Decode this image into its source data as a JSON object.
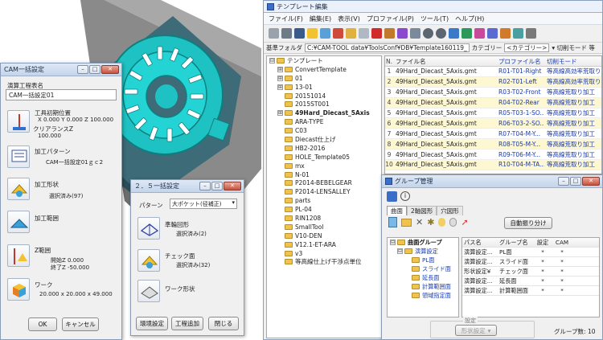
{
  "cam_dialog": {
    "title": "CAM一括設定",
    "section_label": "演算工程表名",
    "process_name": "CAM一括設定01",
    "tool_pos_label": "工具初期位置",
    "tool_pos_value": "X 0.000 Y 0.000 Z 100.000",
    "clearance_label": "クリアランスZ",
    "clearance_value": "100.000",
    "pattern_label": "加工パターン",
    "pattern_value": "CAM一括設定01ｇｃ2",
    "shape_label": "加工形状",
    "shape_value": "選択済み(97)",
    "range_label": "加工範囲",
    "zrange_label": "Z範囲",
    "zstart_value": "開始Z 0.000",
    "zend_value": "終了Z -50.000",
    "work_label": "ワーク",
    "work_value": "20.000 x 20.000 x 49.000",
    "ok_label": "OK",
    "cancel_label": "キャンセル"
  },
  "five_axis_dialog": {
    "title": "２．５一括設定",
    "pattern_label": "パターン",
    "pattern_select": "大ポケット(径補正)",
    "quasi_label": "準輪回形",
    "quasi_value": "選択済み(2)",
    "check_label": "チェック面",
    "check_value": "選択済み(32)",
    "work_shape_label": "ワーク形状",
    "env_button": "環境設定",
    "add_button": "工程追加",
    "close_button": "閉じる"
  },
  "editor": {
    "title": "テンプレート編集",
    "menus": [
      "ファイル(F)",
      "編集(E)",
      "表示(V)",
      "プロファイル(P)",
      "ツール(T)",
      "ヘルプ(H)"
    ],
    "path_label": "基準フォルダ",
    "path_value": "C:¥CAM-TOOL data¥ToolsConf¥DB¥Template160119_",
    "category_label": "カテゴリー",
    "category_value": "<カテゴリー>",
    "mode_label": "▾ 切削モード 等",
    "tree": [
      {
        "label": "テンプレート",
        "expander": "⊟",
        "indent": 0
      },
      {
        "label": "ConvertTemplate",
        "expander": "⊞",
        "indent": 1
      },
      {
        "label": "01",
        "expander": "⊞",
        "indent": 1
      },
      {
        "label": "13-01",
        "expander": "⊞",
        "indent": 1
      },
      {
        "label": "20151014",
        "expander": "",
        "indent": 1
      },
      {
        "label": "2015ST001",
        "expander": "",
        "indent": 1
      },
      {
        "label": "49Hard_Diecast_5Axis",
        "expander": "⊞",
        "indent": 1,
        "bold": true
      },
      {
        "label": "ARA-TYPE",
        "expander": "",
        "indent": 1
      },
      {
        "label": "C03",
        "expander": "",
        "indent": 1
      },
      {
        "label": "Diecast仕上げ",
        "expander": "",
        "indent": 1
      },
      {
        "label": "HB2-2016",
        "expander": "",
        "indent": 1
      },
      {
        "label": "HOLE_Template05",
        "expander": "",
        "indent": 1
      },
      {
        "label": "mx",
        "expander": "",
        "indent": 1
      },
      {
        "label": "N-01",
        "expander": "",
        "indent": 1
      },
      {
        "label": "P2014-BEBELGEAR",
        "expander": "",
        "indent": 1
      },
      {
        "label": "P2014-LENSALLEY",
        "expander": "",
        "indent": 1
      },
      {
        "label": "parts",
        "expander": "",
        "indent": 1
      },
      {
        "label": "PL-04",
        "expander": "",
        "indent": 1
      },
      {
        "label": "RIN1208",
        "expander": "",
        "indent": 1
      },
      {
        "label": "SmallTool",
        "expander": "",
        "indent": 1
      },
      {
        "label": "V10-DEN",
        "expander": "",
        "indent": 1
      },
      {
        "label": "V12.1-ET-ARA",
        "expander": "",
        "indent": 1
      },
      {
        "label": "v3",
        "expander": "",
        "indent": 1
      },
      {
        "label": "等高線仕上げ干渉点単位",
        "expander": "",
        "indent": 1
      }
    ],
    "table_headers": [
      "N.",
      "ファイル名",
      "プロファイル名",
      "切削モード"
    ],
    "table_rows": [
      {
        "n": "1",
        "file": "49Hard_Diecast_5Axis.gmt",
        "profile": "R01-T01-Right",
        "mode": "等高線高効率荒取り"
      },
      {
        "n": "2",
        "file": "49Hard_Diecast_5Axis.gmt",
        "profile": "R02-T01-Left",
        "mode": "等高線高効率荒取り"
      },
      {
        "n": "3",
        "file": "49Hard_Diecast_5Axis.gmt",
        "profile": "R03-T02-Front",
        "mode": "等高線荒取り加工"
      },
      {
        "n": "4",
        "file": "49Hard_Diecast_5Axis.gmt",
        "profile": "R04-T02-Rear",
        "mode": "等高線荒取り加工"
      },
      {
        "n": "5",
        "file": "49Hard_Diecast_5Axis.gmt",
        "profile": "R05-T03-1-SO...",
        "mode": "等高線荒取り加工"
      },
      {
        "n": "6",
        "file": "49Hard_Diecast_5Axis.gmt",
        "profile": "R06-T03-2-SO...",
        "mode": "等高線荒取り加工"
      },
      {
        "n": "7",
        "file": "49Hard_Diecast_5Axis.gmt",
        "profile": "R07-T04-M-Y...",
        "mode": "等高線荒取り加工"
      },
      {
        "n": "8",
        "file": "49Hard_Diecast_5Axis.gmt",
        "profile": "R08-T05-M-Y...",
        "mode": "等高線荒取り加工"
      },
      {
        "n": "9",
        "file": "49Hard_Diecast_5Axis.gmt",
        "profile": "R09-T06-M-Y...",
        "mode": "等高線荒取り加工"
      },
      {
        "n": "10",
        "file": "49Hard_Diecast_5Axis.gmt",
        "profile": "R10-T04-M-TA...",
        "mode": "等高線荒取り加工"
      }
    ]
  },
  "group_manager": {
    "title": "グループ管理",
    "tabs": [
      "曲面",
      "2軸図形",
      "穴図形"
    ],
    "auto_button": "自動振り分け",
    "tree": [
      {
        "label": "曲面グループ",
        "indent": 0,
        "expander": "⊟",
        "bold": true
      },
      {
        "label": "演算設定",
        "indent": 1,
        "expander": "⊟"
      },
      {
        "label": "PL面",
        "indent": 2,
        "expander": ""
      },
      {
        "label": "スライド面",
        "indent": 2,
        "expander": ""
      },
      {
        "label": "延長面",
        "indent": 2,
        "expander": ""
      },
      {
        "label": "計算範囲面",
        "indent": 2,
        "expander": ""
      },
      {
        "label": "領域指定面",
        "indent": 2,
        "expander": ""
      }
    ],
    "headers": [
      "パス名",
      "グループ名",
      "設定",
      "CAM"
    ],
    "rows": [
      {
        "path": "演算設定...",
        "group": "PL面",
        "setting": "*",
        "cam": "*"
      },
      {
        "path": "演算設定...",
        "group": "スライド面",
        "setting": "*",
        "cam": "*"
      },
      {
        "path": "形状設定¥",
        "group": "チェック面",
        "setting": "*",
        "cam": "*"
      },
      {
        "path": "演算設定...",
        "group": "延長面",
        "setting": "*",
        "cam": "*"
      },
      {
        "path": "演算設定...",
        "group": "計算範囲面",
        "setting": "*",
        "cam": "*"
      }
    ],
    "setting_group_label": "設定",
    "shape_setting_button": "形状設定",
    "count_label": "グループ数: 10"
  },
  "colors": {
    "accent_blue": "#1b3fb0",
    "row_highlight": "#fdf7d2",
    "model_teal": "#1fc2c2",
    "model_dark": "#3d6b78",
    "fixture_gray": "#8c8c8c"
  }
}
